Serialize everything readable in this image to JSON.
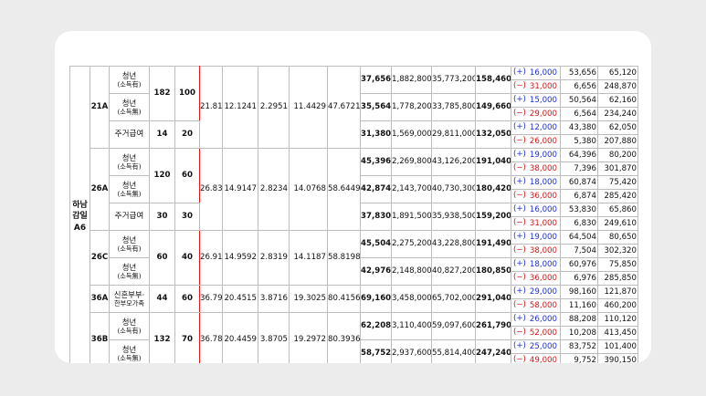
{
  "region": "하남\n감일\nA6",
  "rows": [
    {
      "type": "21A",
      "subs": [
        {
          "label": "청년",
          "note": "(소득有)"
        },
        {
          "label": "청년",
          "note": "(소득無)"
        },
        {
          "label": "주거급여",
          "note": ""
        }
      ],
      "counts": [
        {
          "a": "182",
          "b": "100"
        },
        {
          "a": "14",
          "b": "20"
        }
      ],
      "n1": "21.81",
      "n2": "12.1241",
      "n3": "2.2951",
      "n4": "11.4429",
      "n5": "47.6721",
      "units": [
        {
          "p": "37,656",
          "d": "1,882,800",
          "m": "35,773,200",
          "r": "158,460",
          "c": [
            {
              "s": "(+)",
              "v": "16,000",
              "a": "53,656",
              "b": "65,120",
              "k": "pos"
            },
            {
              "s": "(−)",
              "v": "31,000",
              "a": "6,656",
              "b": "248,870",
              "k": "neg"
            }
          ]
        },
        {
          "p": "35,564",
          "d": "1,778,200",
          "m": "33,785,800",
          "r": "149,660",
          "c": [
            {
              "s": "(+)",
              "v": "15,000",
              "a": "50,564",
              "b": "62,160",
              "k": "pos"
            },
            {
              "s": "(−)",
              "v": "29,000",
              "a": "6,564",
              "b": "234,240",
              "k": "neg"
            }
          ]
        },
        {
          "p": "31,380",
          "d": "1,569,000",
          "m": "29,811,000",
          "r": "132,050",
          "c": [
            {
              "s": "(+)",
              "v": "12,000",
              "a": "43,380",
              "b": "62,050",
              "k": "pos"
            },
            {
              "s": "(−)",
              "v": "26,000",
              "a": "5,380",
              "b": "207,880",
              "k": "neg"
            }
          ]
        }
      ]
    },
    {
      "type": "26A",
      "subs": [
        {
          "label": "청년",
          "note": "(소득有)"
        },
        {
          "label": "청년",
          "note": "(소득無)"
        },
        {
          "label": "주거급여",
          "note": ""
        }
      ],
      "counts": [
        {
          "a": "120",
          "b": "60"
        },
        {
          "a": "30",
          "b": "30"
        }
      ],
      "n1": "26.83",
      "n2": "14.9147",
      "n3": "2.8234",
      "n4": "14.0768",
      "n5": "58.6449",
      "units": [
        {
          "p": "45,396",
          "d": "2,269,800",
          "m": "43,126,200",
          "r": "191,040",
          "c": [
            {
              "s": "(+)",
              "v": "19,000",
              "a": "64,396",
              "b": "80,200",
              "k": "pos"
            },
            {
              "s": "(−)",
              "v": "38,000",
              "a": "7,396",
              "b": "301,870",
              "k": "neg"
            }
          ]
        },
        {
          "p": "42,874",
          "d": "2,143,700",
          "m": "40,730,300",
          "r": "180,420",
          "c": [
            {
              "s": "(+)",
              "v": "18,000",
              "a": "60,874",
              "b": "75,420",
              "k": "pos"
            },
            {
              "s": "(−)",
              "v": "36,000",
              "a": "6,874",
              "b": "285,420",
              "k": "neg"
            }
          ]
        },
        {
          "p": "37,830",
          "d": "1,891,500",
          "m": "35,938,500",
          "r": "159,200",
          "c": [
            {
              "s": "(+)",
              "v": "16,000",
              "a": "53,830",
              "b": "65,860",
              "k": "pos"
            },
            {
              "s": "(−)",
              "v": "31,000",
              "a": "6,830",
              "b": "249,610",
              "k": "neg"
            }
          ]
        }
      ]
    },
    {
      "type": "26C",
      "subs": [
        {
          "label": "청년",
          "note": "(소득有)"
        },
        {
          "label": "청년",
          "note": "(소득無)"
        }
      ],
      "counts": [
        {
          "a": "60",
          "b": "40"
        }
      ],
      "n1": "26.91",
      "n2": "14.9592",
      "n3": "2.8319",
      "n4": "14.1187",
      "n5": "58.8198",
      "units": [
        {
          "p": "45,504",
          "d": "2,275,200",
          "m": "43,228,800",
          "r": "191,490",
          "c": [
            {
              "s": "(+)",
              "v": "19,000",
              "a": "64,504",
              "b": "80,650",
              "k": "pos"
            },
            {
              "s": "(−)",
              "v": "38,000",
              "a": "7,504",
              "b": "302,320",
              "k": "neg"
            }
          ]
        },
        {
          "p": "42,976",
          "d": "2,148,800",
          "m": "40,827,200",
          "r": "180,850",
          "c": [
            {
              "s": "(+)",
              "v": "18,000",
              "a": "60,976",
              "b": "75,850",
              "k": "pos"
            },
            {
              "s": "(−)",
              "v": "36,000",
              "a": "6,976",
              "b": "285,850",
              "k": "neg"
            }
          ]
        }
      ]
    },
    {
      "type": "36A",
      "subs": [
        {
          "label": "신혼부부·",
          "note": "한부모가족"
        }
      ],
      "counts": [
        {
          "a": "44",
          "b": "60"
        }
      ],
      "n1": "36.79",
      "n2": "20.4515",
      "n3": "3.8716",
      "n4": "19.3025",
      "n5": "80.4156",
      "units": [
        {
          "p": "69,160",
          "d": "3,458,000",
          "m": "65,702,000",
          "r": "291,040",
          "c": [
            {
              "s": "(+)",
              "v": "29,000",
              "a": "98,160",
              "b": "121,870",
              "k": "pos"
            },
            {
              "s": "(−)",
              "v": "58,000",
              "a": "11,160",
              "b": "460,200",
              "k": "neg"
            }
          ]
        }
      ]
    },
    {
      "type": "36B",
      "subs": [
        {
          "label": "청년",
          "note": "(소득有)"
        },
        {
          "label": "청년",
          "note": "(소득無)"
        }
      ],
      "counts": [
        {
          "a": "132",
          "b": "70"
        }
      ],
      "n1": "36.78",
      "n2": "20.4459",
      "n3": "3.8705",
      "n4": "19.2972",
      "n5": "80.3936",
      "units": [
        {
          "p": "62,208",
          "d": "3,110,400",
          "m": "59,097,600",
          "r": "261,790",
          "c": [
            {
              "s": "(+)",
              "v": "26,000",
              "a": "88,208",
              "b": "110,120",
              "k": "pos"
            },
            {
              "s": "(−)",
              "v": "52,000",
              "a": "10,208",
              "b": "413,450",
              "k": "neg"
            }
          ]
        },
        {
          "p": "58,752",
          "d": "2,937,600",
          "m": "55,814,400",
          "r": "247,240",
          "c": [
            {
              "s": "(+)",
              "v": "25,000",
              "a": "83,752",
              "b": "101,400",
              "k": "pos"
            },
            {
              "s": "(−)",
              "v": "49,000",
              "a": "9,752",
              "b": "390,150",
              "k": "neg"
            }
          ]
        }
      ]
    }
  ]
}
